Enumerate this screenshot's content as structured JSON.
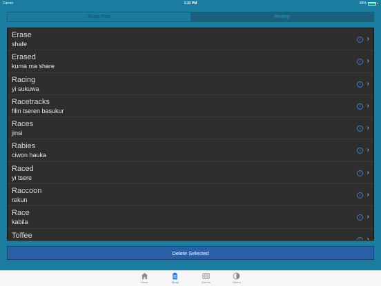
{
  "status_bar": {
    "carrier": "Carrier",
    "time": "1:32 PM",
    "battery": "89%",
    "battery_color": "#4cd964"
  },
  "segmented_control": {
    "tabs": [
      {
        "label": "Study Plan",
        "selected": true
      },
      {
        "label": "History",
        "selected": false
      }
    ]
  },
  "list": {
    "items": [
      {
        "word": "Erase",
        "translation": "shafe"
      },
      {
        "word": "Erased",
        "translation": "kuma ma share"
      },
      {
        "word": "Racing",
        "translation": "yi sukuwa"
      },
      {
        "word": "Racetracks",
        "translation": "filin tseren basukur"
      },
      {
        "word": "Races",
        "translation": "jinsi"
      },
      {
        "word": "Rabies",
        "translation": "ciwon hauka"
      },
      {
        "word": "Raced",
        "translation": "yi tsere"
      },
      {
        "word": "Raccoon",
        "translation": "rekun"
      },
      {
        "word": "Race",
        "translation": "kabila"
      },
      {
        "word": "Toffee",
        "translation": ""
      }
    ],
    "info_icon": "info-icon",
    "chevron_icon": "chevron-right-icon"
  },
  "actions": {
    "delete_label": "Delete Selected"
  },
  "tab_bar": {
    "items": [
      {
        "label": "Home",
        "icon": "home-icon",
        "active": false
      },
      {
        "label": "Study",
        "icon": "clipboard-icon",
        "active": true
      },
      {
        "label": "Games",
        "icon": "games-icon",
        "active": false
      },
      {
        "label": "Others",
        "icon": "contrast-icon",
        "active": false
      }
    ]
  },
  "colors": {
    "background": "#1a7c9e",
    "list_background": "#2e2e2e",
    "delete_button": "#2a5fa8",
    "accent": "#2f80ed"
  }
}
